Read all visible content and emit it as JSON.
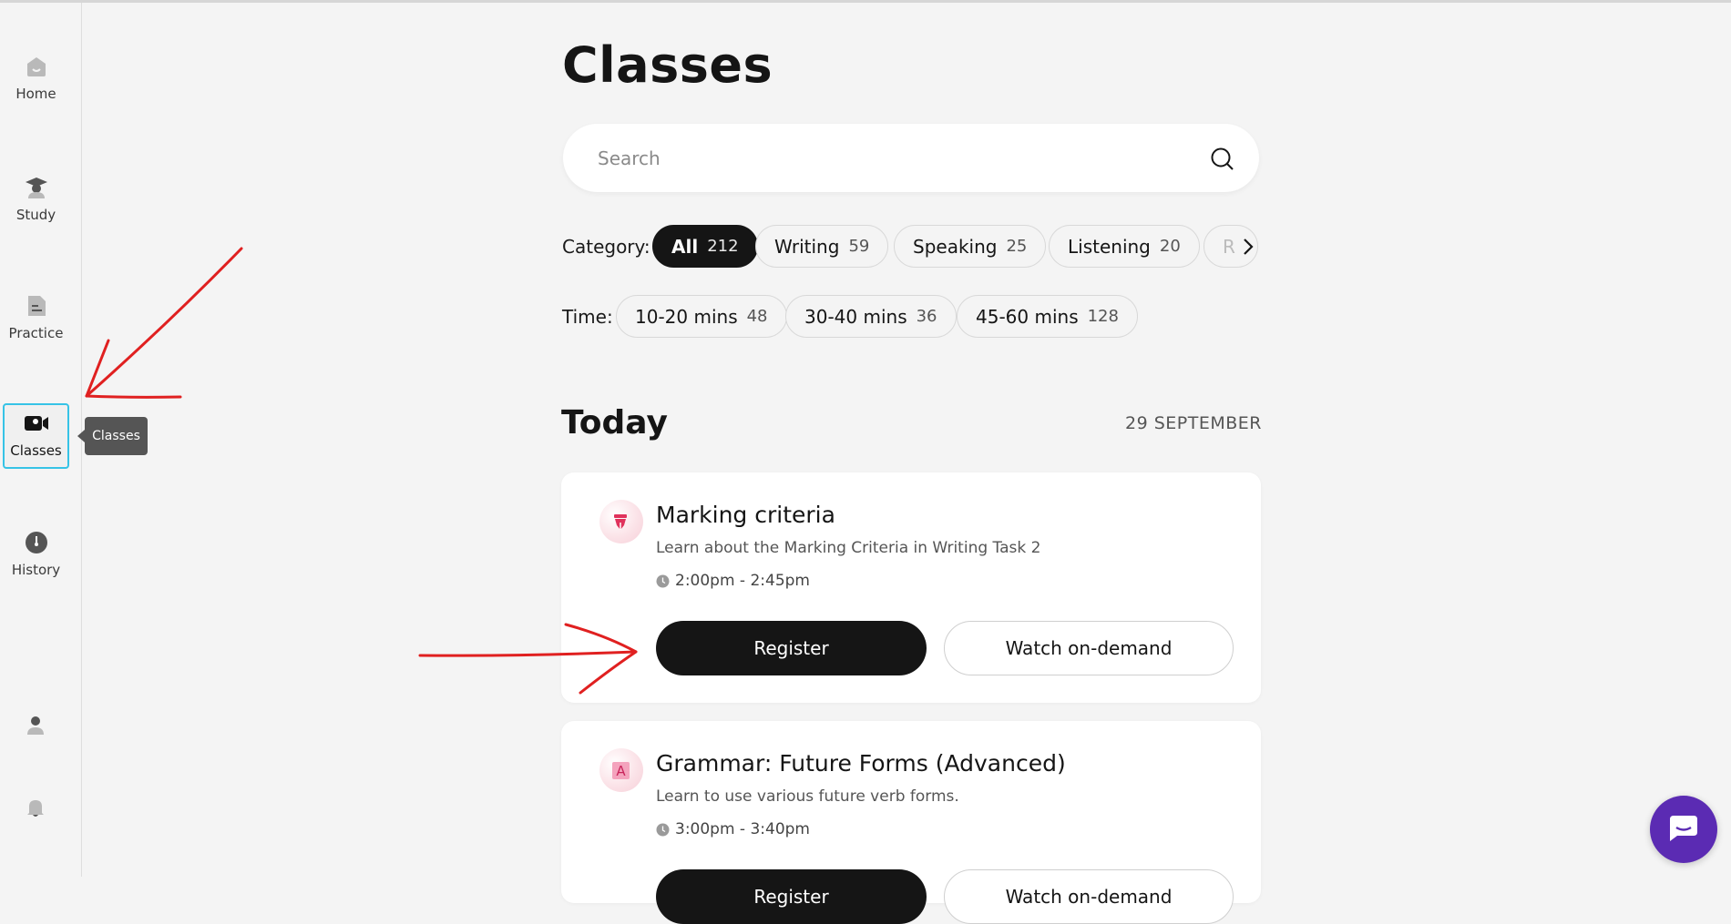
{
  "sidebar": {
    "items": [
      {
        "label": "Home",
        "icon": "home-icon"
      },
      {
        "label": "Study",
        "icon": "graduation-cap-icon"
      },
      {
        "label": "Practice",
        "icon": "document-icon"
      },
      {
        "label": "Classes",
        "icon": "video-camera-icon",
        "active": true
      },
      {
        "label": "History",
        "icon": "clock-icon"
      }
    ],
    "tooltip": "Classes",
    "bottom_icons": [
      "profile-icon",
      "bell-icon"
    ]
  },
  "page": {
    "title": "Classes"
  },
  "search": {
    "placeholder": "Search",
    "icon": "search-icon"
  },
  "filters": {
    "category": {
      "label": "Category:",
      "chips": [
        {
          "label": "All",
          "count": "212",
          "selected": true
        },
        {
          "label": "Writing",
          "count": "59"
        },
        {
          "label": "Speaking",
          "count": "25"
        },
        {
          "label": "Listening",
          "count": "20"
        },
        {
          "label": "R",
          "count": ""
        }
      ]
    },
    "time": {
      "label": "Time:",
      "chips": [
        {
          "label": "10-20 mins",
          "count": "48"
        },
        {
          "label": "30-40 mins",
          "count": "36"
        },
        {
          "label": "45-60 mins",
          "count": "128"
        }
      ]
    }
  },
  "today": {
    "title": "Today",
    "date": "29 SEPTEMBER",
    "classes": [
      {
        "title": "Marking criteria",
        "description": "Learn about the Marking Criteria in Writing Task 2",
        "time": "2:00pm - 2:45pm",
        "icon": "pen-nib-icon",
        "register_label": "Register",
        "watch_label": "Watch on-demand"
      },
      {
        "title": "Grammar: Future Forms (Advanced)",
        "description": "Learn to use various future verb forms.",
        "time": "3:00pm - 3:40pm",
        "icon": "letter-a-icon",
        "icon_letter": "A",
        "register_label": "Register",
        "watch_label": "Watch on-demand"
      }
    ]
  },
  "colors": {
    "accent_active": "#36c3e6",
    "primary_button": "#151515",
    "chat_button": "#5b2bb3",
    "annotation_red": "#e02020"
  }
}
